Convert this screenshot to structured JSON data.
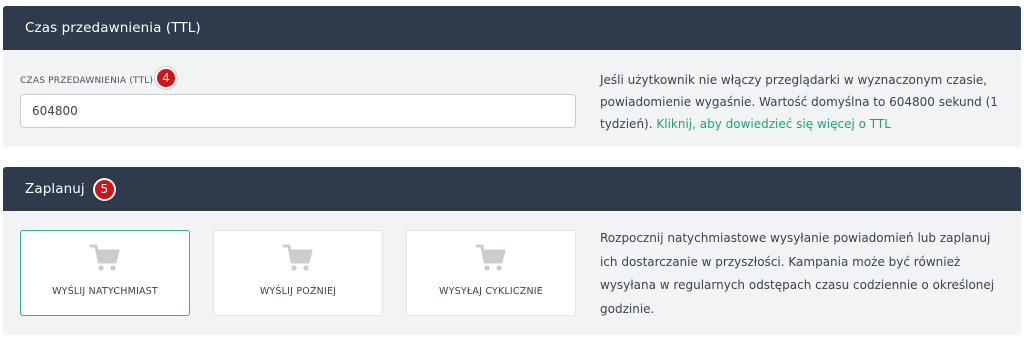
{
  "ttl_section": {
    "header_title": "Czas przedawnienia (TTL)",
    "field_label": "CZAS PRZEDAWNIENIA (TTL)",
    "badge": "4",
    "input_value": "604800",
    "help_text": "Jeśli użytkownik nie włączy przeglądarki w wyznaczonym czasie, powiadomienie wygaśnie. Wartość domyślna to 604800 sekund (1 tydzień). ",
    "help_link": "Kliknij, aby dowiedzieć się więcej o TTL"
  },
  "schedule_section": {
    "header_title": "Zaplanuj",
    "badge": "5",
    "options": [
      {
        "label": "WYŚLIJ NATYCHMIAST",
        "icon": "cart-icon",
        "selected": true
      },
      {
        "label": "WYŚLIJ POŹNIEJ",
        "icon": "cart-icon",
        "selected": false
      },
      {
        "label": "WYSYŁAJ CYKLICZNIE",
        "icon": "cart-icon",
        "selected": false
      }
    ],
    "help_text": "Rozpocznij natychmiastowe wysyłanie powiadomień lub zaplanuj ich dostarczanie w przyszłości. Kampania może być również wysyłana w regularnych odstępach czasu codziennie o określonej godzinie."
  },
  "colors": {
    "header_bg": "#2e3b4d",
    "panel_bg": "#f1f3f5",
    "badge": "#d01515",
    "link": "#1fa37d",
    "selected_border": "#2fb38e",
    "cart_icon": "#c9cdd2"
  }
}
